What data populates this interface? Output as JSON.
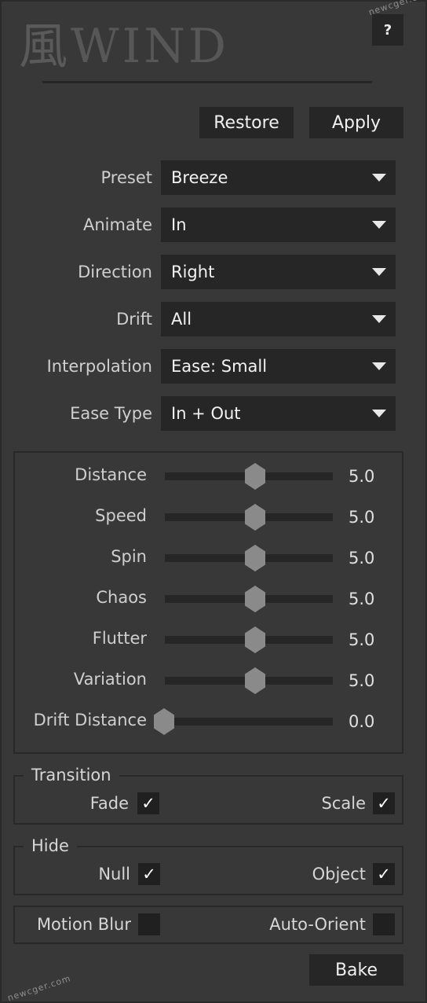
{
  "header": {
    "logo_kanji": "風",
    "logo_text": "WIND",
    "help_label": "?"
  },
  "watermark": "newcger.com",
  "actions": {
    "restore_label": "Restore",
    "apply_label": "Apply",
    "bake_label": "Bake"
  },
  "dropdowns": [
    {
      "label": "Preset",
      "value": "Breeze"
    },
    {
      "label": "Animate",
      "value": "In"
    },
    {
      "label": "Direction",
      "value": "Right"
    },
    {
      "label": "Drift",
      "value": "All"
    },
    {
      "label": "Interpolation",
      "value": "Ease: Small"
    },
    {
      "label": "Ease Type",
      "value": "In + Out"
    }
  ],
  "sliders": [
    {
      "label": "Distance",
      "value": "5.0",
      "level": 0.5
    },
    {
      "label": "Speed",
      "value": "5.0",
      "level": 0.5
    },
    {
      "label": "Spin",
      "value": "5.0",
      "level": 0.5
    },
    {
      "label": "Chaos",
      "value": "5.0",
      "level": 0.5
    },
    {
      "label": "Flutter",
      "value": "5.0",
      "level": 0.5
    },
    {
      "label": "Variation",
      "value": "5.0",
      "level": 0.5
    },
    {
      "label": "Drift Distance",
      "value": "0.0",
      "level": 0.0
    }
  ],
  "transition": {
    "title": "Transition",
    "fade_label": "Fade",
    "fade_checked": true,
    "scale_label": "Scale",
    "scale_checked": true
  },
  "hide": {
    "title": "Hide",
    "null_label": "Null",
    "null_checked": true,
    "object_label": "Object",
    "object_checked": true
  },
  "options": {
    "motion_blur_label": "Motion Blur",
    "motion_blur_checked": false,
    "auto_orient_label": "Auto-Orient",
    "auto_orient_checked": false
  },
  "check_glyph": "✓",
  "colors": {
    "panel_bg": "#383838",
    "control_bg": "#262626",
    "thumb": "#8a8a8a"
  }
}
